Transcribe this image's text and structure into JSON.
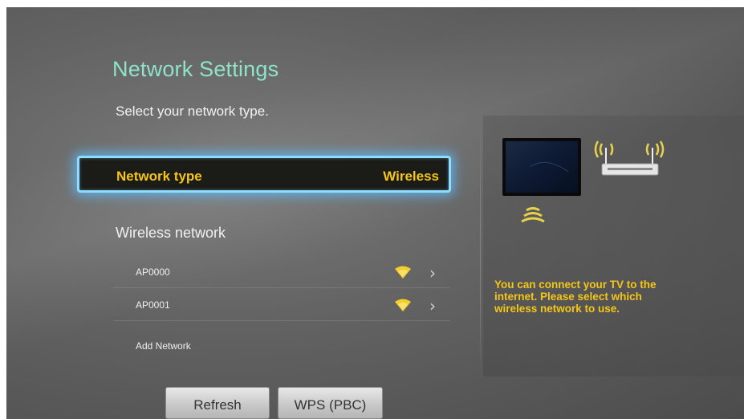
{
  "header": {
    "title": "Network Settings",
    "subtitle": "Select your network type."
  },
  "network_type": {
    "label": "Network type",
    "value": "Wireless"
  },
  "wireless": {
    "section_title": "Wireless network",
    "items": [
      {
        "name": "AP0000",
        "signal_icon": "wifi-signal-icon",
        "action_icon": "chevron-right-icon"
      },
      {
        "name": "AP0001",
        "signal_icon": "wifi-signal-icon",
        "action_icon": "chevron-right-icon"
      },
      {
        "name": "Add Network"
      }
    ]
  },
  "info_panel": {
    "text": "You can connect your TV to the internet. Please select which wireless network to use."
  },
  "buttons": {
    "refresh": "Refresh",
    "wps": "WPS (PBC)"
  },
  "colors": {
    "title": "#8fe3c8",
    "highlight": "#f5c518",
    "focus_glow": "#8edcff"
  }
}
